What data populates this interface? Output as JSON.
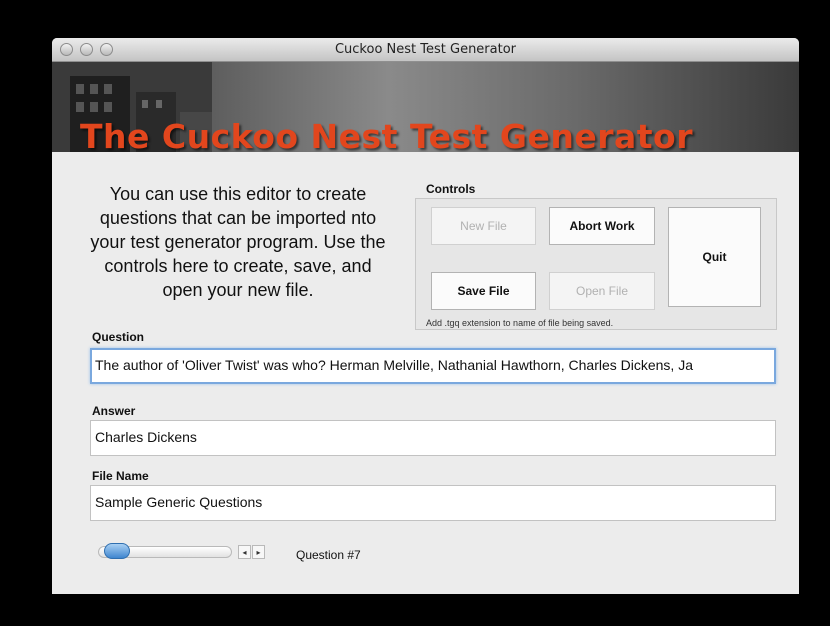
{
  "window": {
    "title": "Cuckoo Nest Test Generator"
  },
  "banner": {
    "title": "The Cuckoo Nest Test Generator"
  },
  "intro": {
    "text": "You can use this editor to create questions that can be imported nto your test generator program. Use the controls here to create, save, and open your new file."
  },
  "controls": {
    "label": "Controls",
    "new_file": "New File",
    "abort_work": "Abort Work",
    "quit": "Quit",
    "save_file": "Save File",
    "open_file": "Open File",
    "hint": "Add .tgq extension to name of file being saved."
  },
  "question": {
    "label": "Question",
    "value": "The author of 'Oliver Twist' was who? Herman Melville, Nathanial Hawthorn, Charles Dickens, Ja"
  },
  "answer": {
    "label": "Answer",
    "value": "Charles Dickens"
  },
  "file_name": {
    "label": "File Name",
    "value": "Sample Generic Questions"
  },
  "navigation": {
    "question_counter": "Question #7",
    "prev_glyph": "◂",
    "next_glyph": "▸"
  },
  "colors": {
    "banner_title": "#e2461d",
    "focus_ring": "#7aa8de",
    "slider_thumb": "#3f86cf"
  },
  "icons": [
    "close-icon",
    "minimize-icon",
    "zoom-icon",
    "previous-arrow-icon",
    "next-arrow-icon"
  ]
}
